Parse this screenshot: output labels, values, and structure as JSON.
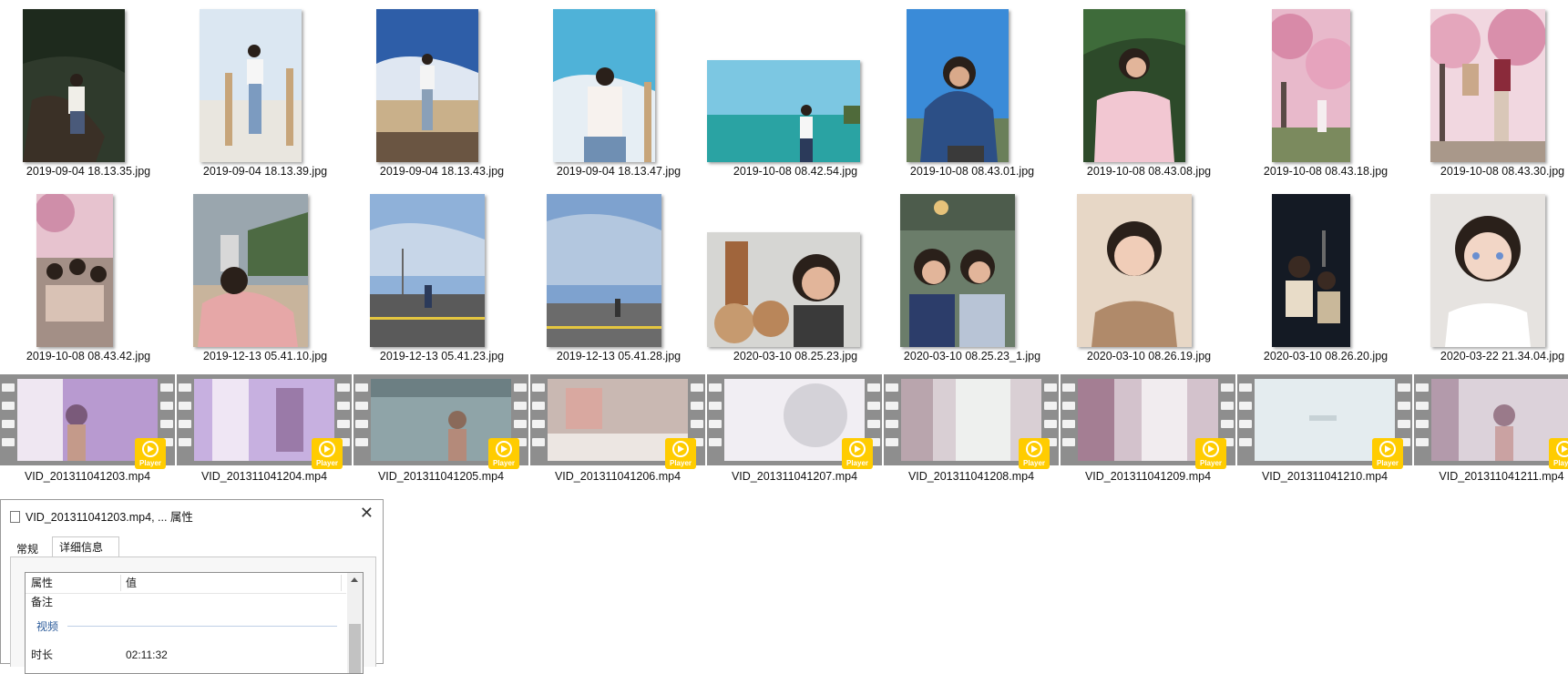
{
  "photos_row1": [
    {
      "name": "2019-09-04 18.13.35.jpg"
    },
    {
      "name": "2019-09-04 18.13.39.jpg"
    },
    {
      "name": "2019-09-04 18.13.43.jpg"
    },
    {
      "name": "2019-09-04 18.13.47.jpg"
    },
    {
      "name": "2019-10-08 08.42.54.jpg"
    },
    {
      "name": "2019-10-08 08.43.01.jpg"
    },
    {
      "name": "2019-10-08 08.43.08.jpg"
    },
    {
      "name": "2019-10-08 08.43.18.jpg"
    },
    {
      "name": "2019-10-08 08.43.30.jpg"
    }
  ],
  "photos_row2": [
    {
      "name": "2019-10-08 08.43.42.jpg"
    },
    {
      "name": "2019-12-13 05.41.10.jpg"
    },
    {
      "name": "2019-12-13 05.41.23.jpg"
    },
    {
      "name": "2019-12-13 05.41.28.jpg"
    },
    {
      "name": "2020-03-10 08.25.23.jpg"
    },
    {
      "name": "2020-03-10 08.25.23_1.jpg"
    },
    {
      "name": "2020-03-10 08.26.19.jpg"
    },
    {
      "name": "2020-03-10 08.26.20.jpg"
    },
    {
      "name": "2020-03-22 21.34.04.jpg"
    }
  ],
  "videos": [
    {
      "name": "VID_201311041203.mp4"
    },
    {
      "name": "VID_201311041204.mp4"
    },
    {
      "name": "VID_201311041205.mp4"
    },
    {
      "name": "VID_201311041206.mp4"
    },
    {
      "name": "VID_201311041207.mp4"
    },
    {
      "name": "VID_201311041208.mp4"
    },
    {
      "name": "VID_201311041209.mp4"
    },
    {
      "name": "VID_201311041210.mp4"
    },
    {
      "name": "VID_201311041211.mp4"
    }
  ],
  "player_badge_label": "Player",
  "dialog": {
    "title": "VID_201311041203.mp4, ... 属性",
    "tabs": [
      {
        "label": "常规"
      },
      {
        "label": "详细信息"
      }
    ],
    "columns": {
      "property": "属性",
      "value": "值"
    },
    "rows": [
      {
        "property": "备注",
        "value": ""
      }
    ],
    "section": "视频",
    "section_rows": [
      {
        "property": "时长",
        "value": "02:11:32"
      }
    ]
  },
  "colors": {
    "badge": "#ffcc00",
    "selection": "#d9d9d9",
    "section_label": "#2a5a9a"
  }
}
